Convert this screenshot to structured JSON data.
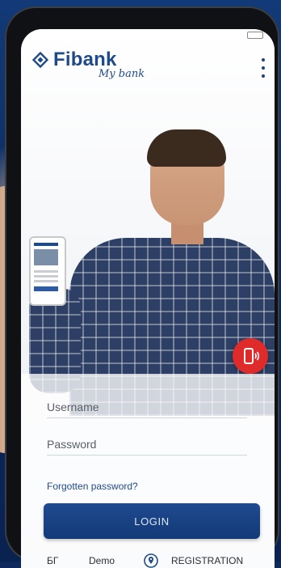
{
  "brand": {
    "name": "Fibank",
    "tagline": "My bank",
    "primary_color": "#1f4a8a",
    "accent_color": "#e02b2b"
  },
  "header": {
    "menu_icon": "kebab-menu-icon"
  },
  "form": {
    "username_placeholder": "Username",
    "password_placeholder": "Password",
    "forgot_password": "Forgotten password?",
    "login_label": "LOGIN"
  },
  "nfc": {
    "icon": "phone-nfc-icon"
  },
  "bottom": {
    "language": "БГ",
    "demo": "Demo",
    "location_icon": "location-pin-icon",
    "registration": "REGISTRATION"
  }
}
